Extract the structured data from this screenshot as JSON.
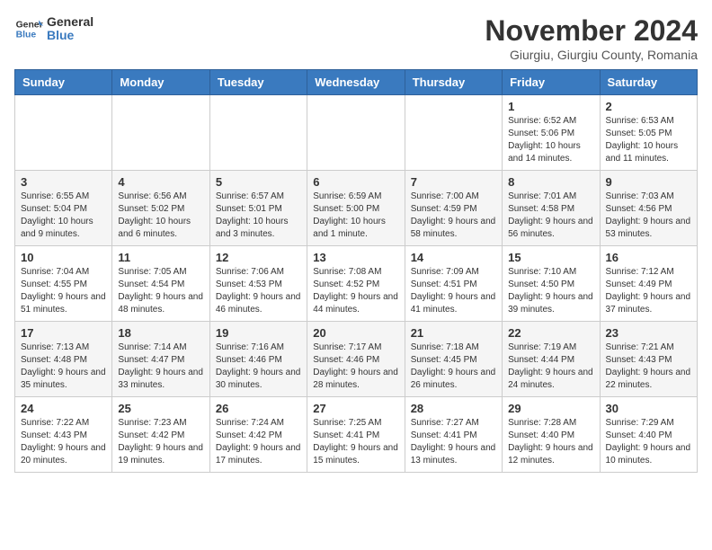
{
  "header": {
    "logo_line1": "General",
    "logo_line2": "Blue",
    "month_year": "November 2024",
    "location": "Giurgiu, Giurgiu County, Romania"
  },
  "days_of_week": [
    "Sunday",
    "Monday",
    "Tuesday",
    "Wednesday",
    "Thursday",
    "Friday",
    "Saturday"
  ],
  "weeks": [
    [
      {
        "day": "",
        "info": ""
      },
      {
        "day": "",
        "info": ""
      },
      {
        "day": "",
        "info": ""
      },
      {
        "day": "",
        "info": ""
      },
      {
        "day": "",
        "info": ""
      },
      {
        "day": "1",
        "info": "Sunrise: 6:52 AM\nSunset: 5:06 PM\nDaylight: 10 hours and 14 minutes."
      },
      {
        "day": "2",
        "info": "Sunrise: 6:53 AM\nSunset: 5:05 PM\nDaylight: 10 hours and 11 minutes."
      }
    ],
    [
      {
        "day": "3",
        "info": "Sunrise: 6:55 AM\nSunset: 5:04 PM\nDaylight: 10 hours and 9 minutes."
      },
      {
        "day": "4",
        "info": "Sunrise: 6:56 AM\nSunset: 5:02 PM\nDaylight: 10 hours and 6 minutes."
      },
      {
        "day": "5",
        "info": "Sunrise: 6:57 AM\nSunset: 5:01 PM\nDaylight: 10 hours and 3 minutes."
      },
      {
        "day": "6",
        "info": "Sunrise: 6:59 AM\nSunset: 5:00 PM\nDaylight: 10 hours and 1 minute."
      },
      {
        "day": "7",
        "info": "Sunrise: 7:00 AM\nSunset: 4:59 PM\nDaylight: 9 hours and 58 minutes."
      },
      {
        "day": "8",
        "info": "Sunrise: 7:01 AM\nSunset: 4:58 PM\nDaylight: 9 hours and 56 minutes."
      },
      {
        "day": "9",
        "info": "Sunrise: 7:03 AM\nSunset: 4:56 PM\nDaylight: 9 hours and 53 minutes."
      }
    ],
    [
      {
        "day": "10",
        "info": "Sunrise: 7:04 AM\nSunset: 4:55 PM\nDaylight: 9 hours and 51 minutes."
      },
      {
        "day": "11",
        "info": "Sunrise: 7:05 AM\nSunset: 4:54 PM\nDaylight: 9 hours and 48 minutes."
      },
      {
        "day": "12",
        "info": "Sunrise: 7:06 AM\nSunset: 4:53 PM\nDaylight: 9 hours and 46 minutes."
      },
      {
        "day": "13",
        "info": "Sunrise: 7:08 AM\nSunset: 4:52 PM\nDaylight: 9 hours and 44 minutes."
      },
      {
        "day": "14",
        "info": "Sunrise: 7:09 AM\nSunset: 4:51 PM\nDaylight: 9 hours and 41 minutes."
      },
      {
        "day": "15",
        "info": "Sunrise: 7:10 AM\nSunset: 4:50 PM\nDaylight: 9 hours and 39 minutes."
      },
      {
        "day": "16",
        "info": "Sunrise: 7:12 AM\nSunset: 4:49 PM\nDaylight: 9 hours and 37 minutes."
      }
    ],
    [
      {
        "day": "17",
        "info": "Sunrise: 7:13 AM\nSunset: 4:48 PM\nDaylight: 9 hours and 35 minutes."
      },
      {
        "day": "18",
        "info": "Sunrise: 7:14 AM\nSunset: 4:47 PM\nDaylight: 9 hours and 33 minutes."
      },
      {
        "day": "19",
        "info": "Sunrise: 7:16 AM\nSunset: 4:46 PM\nDaylight: 9 hours and 30 minutes."
      },
      {
        "day": "20",
        "info": "Sunrise: 7:17 AM\nSunset: 4:46 PM\nDaylight: 9 hours and 28 minutes."
      },
      {
        "day": "21",
        "info": "Sunrise: 7:18 AM\nSunset: 4:45 PM\nDaylight: 9 hours and 26 minutes."
      },
      {
        "day": "22",
        "info": "Sunrise: 7:19 AM\nSunset: 4:44 PM\nDaylight: 9 hours and 24 minutes."
      },
      {
        "day": "23",
        "info": "Sunrise: 7:21 AM\nSunset: 4:43 PM\nDaylight: 9 hours and 22 minutes."
      }
    ],
    [
      {
        "day": "24",
        "info": "Sunrise: 7:22 AM\nSunset: 4:43 PM\nDaylight: 9 hours and 20 minutes."
      },
      {
        "day": "25",
        "info": "Sunrise: 7:23 AM\nSunset: 4:42 PM\nDaylight: 9 hours and 19 minutes."
      },
      {
        "day": "26",
        "info": "Sunrise: 7:24 AM\nSunset: 4:42 PM\nDaylight: 9 hours and 17 minutes."
      },
      {
        "day": "27",
        "info": "Sunrise: 7:25 AM\nSunset: 4:41 PM\nDaylight: 9 hours and 15 minutes."
      },
      {
        "day": "28",
        "info": "Sunrise: 7:27 AM\nSunset: 4:41 PM\nDaylight: 9 hours and 13 minutes."
      },
      {
        "day": "29",
        "info": "Sunrise: 7:28 AM\nSunset: 4:40 PM\nDaylight: 9 hours and 12 minutes."
      },
      {
        "day": "30",
        "info": "Sunrise: 7:29 AM\nSunset: 4:40 PM\nDaylight: 9 hours and 10 minutes."
      }
    ]
  ]
}
